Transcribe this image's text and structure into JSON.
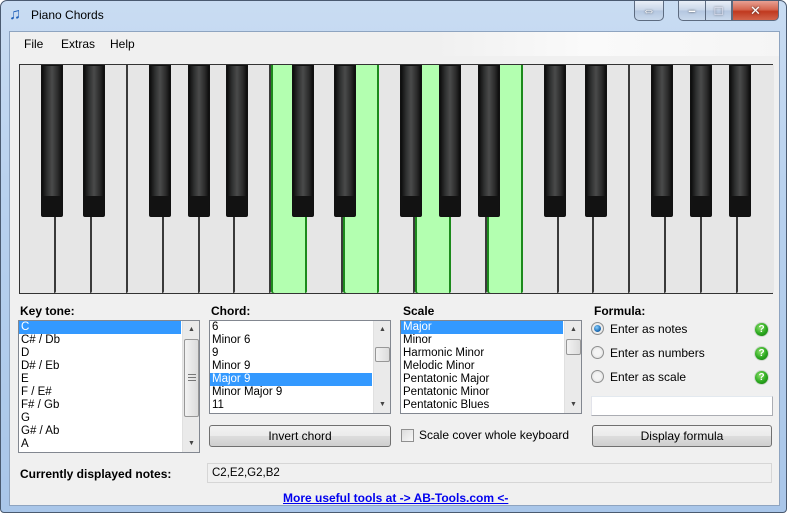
{
  "window": {
    "title": "Piano Chords",
    "icon": "music-note-icon",
    "controls": {
      "resize": "⇔",
      "minimize": "–",
      "maximize": "□",
      "close": "✕"
    }
  },
  "menu": [
    {
      "label": "File"
    },
    {
      "label": "Extras"
    },
    {
      "label": "Help"
    }
  ],
  "keyboard": {
    "white_keys": [
      "C1",
      "D1",
      "E1",
      "F1",
      "G1",
      "A1",
      "B1",
      "C2",
      "D2",
      "E2",
      "F2",
      "G2",
      "A2",
      "B2",
      "C3",
      "D3",
      "E3",
      "F3",
      "G3",
      "A3",
      "B3"
    ],
    "black_keys": [
      "C#1",
      "D#1",
      "F#1",
      "G#1",
      "A#1",
      "C#2",
      "D#2",
      "F#2",
      "G#2",
      "A#2",
      "C#3",
      "D#3",
      "F#3",
      "G#3",
      "A#3"
    ],
    "highlighted": [
      "C2",
      "E2",
      "G2",
      "B2"
    ],
    "highlight_color": "#b3ffb0"
  },
  "key_tone": {
    "label": "Key tone:",
    "items": [
      "C",
      "C# / Db",
      "D",
      "D# / Eb",
      "E",
      "F / E#",
      "F# / Gb",
      "G",
      "G# / Ab",
      "A"
    ],
    "selected": "C"
  },
  "chord": {
    "label": "Chord:",
    "items": [
      "6",
      "Minor 6",
      "9",
      "Minor 9",
      "Major 9",
      "Minor Major 9",
      "11"
    ],
    "selected": "Major 9",
    "invert_button": "Invert chord"
  },
  "scale": {
    "label": "Scale",
    "items": [
      "Major",
      "Minor",
      "Harmonic Minor",
      "Melodic Minor",
      "Pentatonic Major",
      "Pentatonic Minor",
      "Pentatonic Blues"
    ],
    "selected": "Major",
    "cover_checkbox": {
      "label": "Scale cover whole keyboard",
      "checked": false
    }
  },
  "formula": {
    "label": "Formula:",
    "options": [
      {
        "label": "Enter as notes",
        "checked": true
      },
      {
        "label": "Enter as numbers",
        "checked": false
      },
      {
        "label": "Enter as scale",
        "checked": false
      }
    ],
    "help_glyph": "?",
    "input_value": "",
    "display_button": "Display formula"
  },
  "status": {
    "label": "Currently displayed notes:",
    "value": "C2,E2,G2,B2"
  },
  "footer_link": "More useful tools at -> AB-Tools.com <-"
}
